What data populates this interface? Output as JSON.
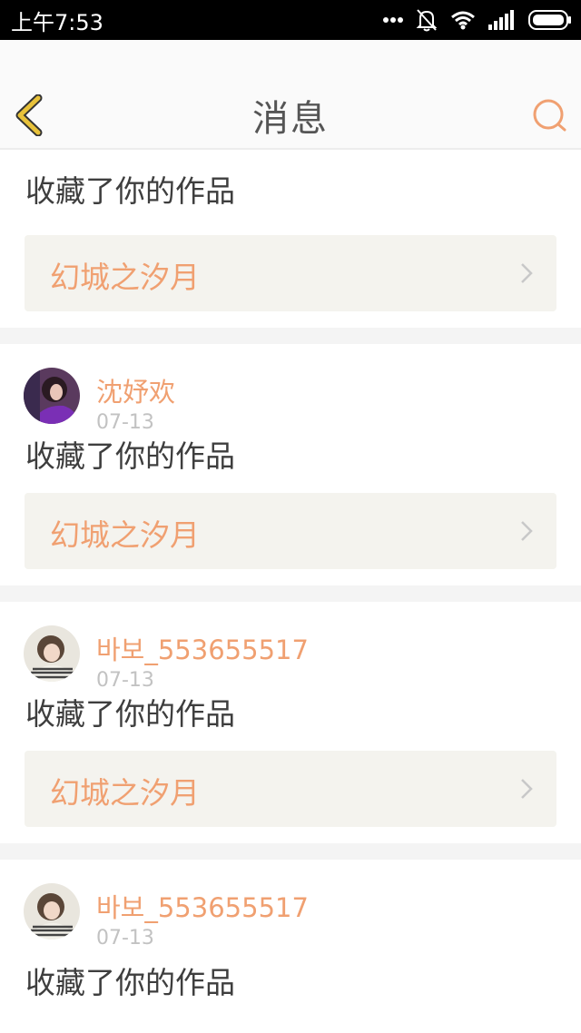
{
  "status_bar": {
    "time": "上午7:53",
    "icons": [
      "dots-icon",
      "bell-off-icon",
      "wifi-icon",
      "signal-icon",
      "battery-icon"
    ]
  },
  "header": {
    "title": "消息",
    "back_icon": "chevron-left-icon",
    "search_icon": "search-icon"
  },
  "colors": {
    "accent": "#f0a071",
    "back_icon": "#e8c23a",
    "work_box_bg": "#f4f3ee",
    "date": "#c2c2c2"
  },
  "messages": [
    {
      "username": "",
      "date": "",
      "action": "收藏了你的作品",
      "work_title": "幻城之汐月"
    },
    {
      "username": "沈妤欢",
      "date": "07-13",
      "action": "收藏了你的作品",
      "work_title": "幻城之汐月"
    },
    {
      "username": "바보_553655517",
      "date": "07-13",
      "action": "收藏了你的作品",
      "work_title": "幻城之汐月"
    },
    {
      "username": "바보_553655517",
      "date": "07-13",
      "action": "收藏了你的作品",
      "work_title": ""
    }
  ]
}
